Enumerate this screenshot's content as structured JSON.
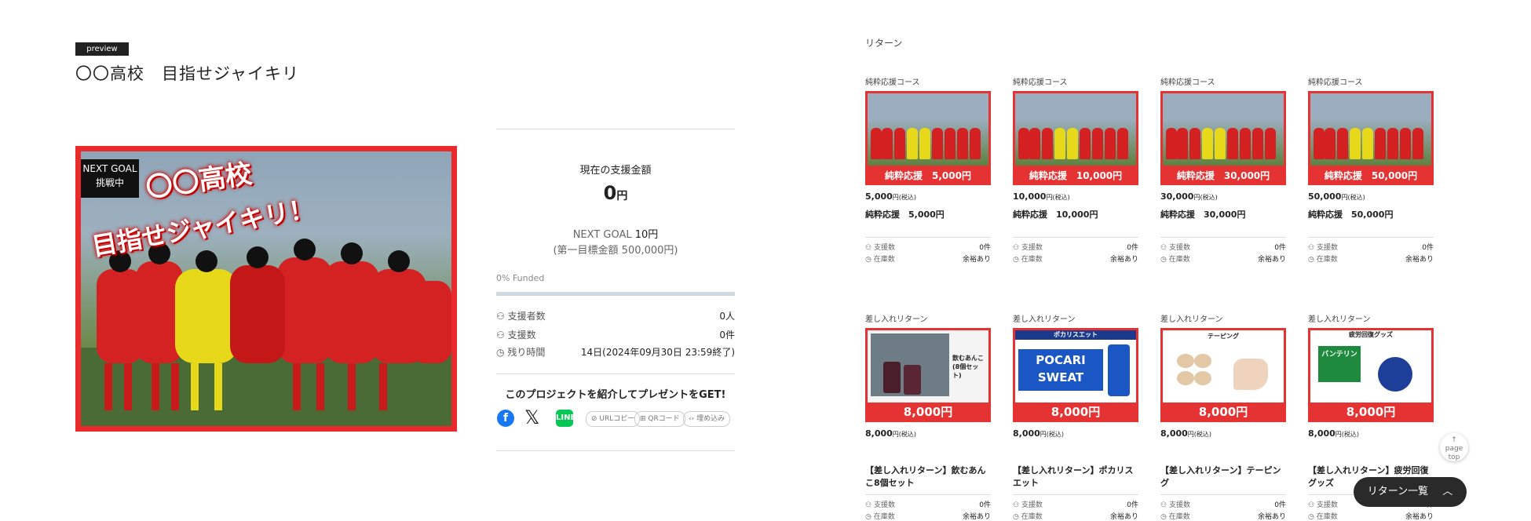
{
  "header": {
    "badge": "preview",
    "title": "〇〇高校　目指せジャイキリ"
  },
  "hero": {
    "next_goal_line1": "NEXT GOAL",
    "next_goal_line2": "挑戦中",
    "headline1": "〇〇高校",
    "headline2": "目指せジャイキリ！"
  },
  "funding": {
    "label": "現在の支援金額",
    "amount": "0",
    "currency": "円",
    "next_goal_prefix": "NEXT GOAL",
    "next_goal_amount": "10円",
    "first_goal": "(第一目標金額 500,000円)",
    "funded_text": "0% Funded",
    "funded_fraction": 0,
    "stats": [
      {
        "label": "支援者数",
        "value": "0人"
      },
      {
        "label": "支援数",
        "value": "0件"
      },
      {
        "label": "残り時間",
        "value": "14日(2024年09月30日 23:59終了)"
      }
    ],
    "share_title": "このプロジェクトを紹介してプレゼントをGET!",
    "share_buttons": [
      "URLコピー",
      "QRコード",
      "埋め込み"
    ]
  },
  "returns": {
    "title": "リターン",
    "row1": [
      {
        "category": "純粋応援コース",
        "banner": "純粋応援　5,000円",
        "price": "5,000",
        "tax": "円(税込)",
        "name": "純粋応援　5,000円",
        "backers_label": "支援数",
        "backers": "0件",
        "stock_label": "在庫数",
        "stock": "余裕あり"
      },
      {
        "category": "純粋応援コース",
        "banner": "純粋応援　10,000円",
        "price": "10,000",
        "tax": "円(税込)",
        "name": "純粋応援　10,000円",
        "backers_label": "支援数",
        "backers": "0件",
        "stock_label": "在庫数",
        "stock": "余裕あり"
      },
      {
        "category": "純粋応援コース",
        "banner": "純粋応援　30,000円",
        "price": "30,000",
        "tax": "円(税込)",
        "name": "純粋応援　30,000円",
        "backers_label": "支援数",
        "backers": "0件",
        "stock_label": "在庫数",
        "stock": "余裕あり"
      },
      {
        "category": "純粋応援コース",
        "banner": "純粋応援　50,000円",
        "price": "50,000",
        "tax": "円(税込)",
        "name": "純粋応援　50,000円",
        "backers_label": "支援数",
        "backers": "0件",
        "stock_label": "在庫数",
        "stock": "余裕あり"
      }
    ],
    "row2": [
      {
        "category": "差し入れリターン",
        "banner": "8,000円",
        "img_text": "飲むあんこ (8個セット)",
        "price": "8,000",
        "tax": "円(税込)",
        "name": "【差し入れリターン】飲むあんこ8個セット",
        "backers_label": "支援数",
        "backers": "0件",
        "stock_label": "在庫数",
        "stock": "余裕あり"
      },
      {
        "category": "差し入れリターン",
        "banner": "8,000円",
        "img_text": "ポカリスエット",
        "img_brand": "POCARI SWEAT",
        "price": "8,000",
        "tax": "円(税込)",
        "name": "【差し入れリターン】ポカリスエット",
        "backers_label": "支援数",
        "backers": "0件",
        "stock_label": "在庫数",
        "stock": "余裕あり"
      },
      {
        "category": "差し入れリターン",
        "banner": "8,000円",
        "img_text": "テーピング",
        "price": "8,000",
        "tax": "円(税込)",
        "name": "【差し入れリターン】テーピング",
        "backers_label": "支援数",
        "backers": "0件",
        "stock_label": "在庫数",
        "stock": "余裕あり"
      },
      {
        "category": "差し入れリターン",
        "banner": "8,000円",
        "img_text": "疲労回復グッズ",
        "img_brand": "バンテリン",
        "price": "8,000",
        "tax": "円(税込)",
        "name": "【差し入れリターン】疲労回復グッズ",
        "backers_label": "支援数",
        "backers": "0件",
        "stock_label": "在庫数",
        "stock": "余裕あり"
      }
    ]
  },
  "page_top": {
    "line1": "page",
    "line2": "top"
  },
  "return_list_button": "リターン一覧",
  "colors": {
    "accent_red": "#e53232",
    "dark": "#2a2a2a"
  },
  "icons": [
    "facebook-icon",
    "x-icon",
    "line-icon",
    "clock-icon",
    "users-icon",
    "chevron-up-icon"
  ]
}
